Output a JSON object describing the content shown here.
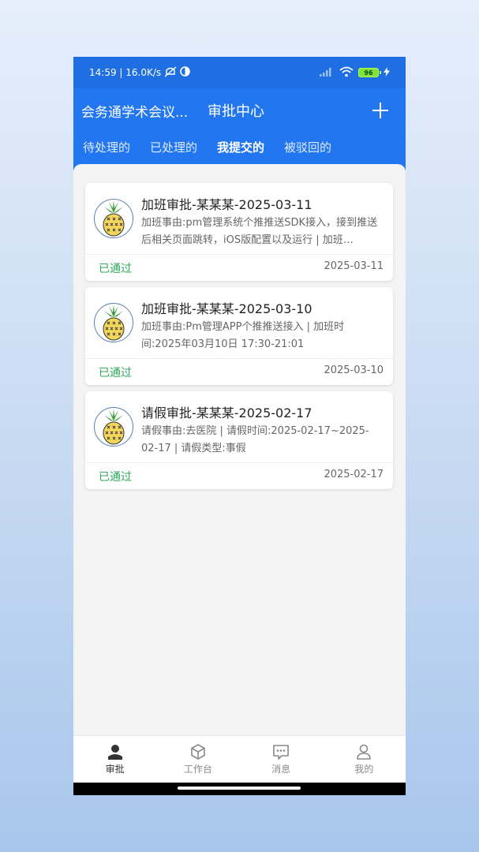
{
  "status_bar": {
    "time_speed": "14:59 | 16.0K/s",
    "battery": "96"
  },
  "header": {
    "app_name": "会务通学术会议...",
    "title": "审批中心"
  },
  "tabs": [
    {
      "label": "待处理的",
      "active": false
    },
    {
      "label": "已处理的",
      "active": false
    },
    {
      "label": "我提交的",
      "active": true
    },
    {
      "label": "被驳回的",
      "active": false
    }
  ],
  "cards": [
    {
      "title": "加班审批-某某某-2025-03-11",
      "desc": "加班事由:pm管理系统个推推送SDK接入，接到推送后相关页面跳转，iOS版配置以及运行 | 加班…",
      "status": "已通过",
      "date": "2025-03-11"
    },
    {
      "title": "加班审批-某某某-2025-03-10",
      "desc": "加班事由:Pm管理APP个推推送接入 | 加班时间:2025年03月10日 17:30-21:01",
      "status": "已通过",
      "date": "2025-03-10"
    },
    {
      "title": "请假审批-某某某-2025-02-17",
      "desc": "请假事由:去医院 | 请假时间:2025-02-17~2025-02-17 | 请假类型:事假",
      "status": "已通过",
      "date": "2025-02-17"
    }
  ],
  "bottom_nav": [
    {
      "label": "审批",
      "icon": "person-icon",
      "active": true
    },
    {
      "label": "工作台",
      "icon": "cube-icon",
      "active": false
    },
    {
      "label": "消息",
      "icon": "message-icon",
      "active": false
    },
    {
      "label": "我的",
      "icon": "user-icon",
      "active": false
    }
  ],
  "colors": {
    "primary": "#2276f0",
    "status_approved": "#2fa85a"
  }
}
